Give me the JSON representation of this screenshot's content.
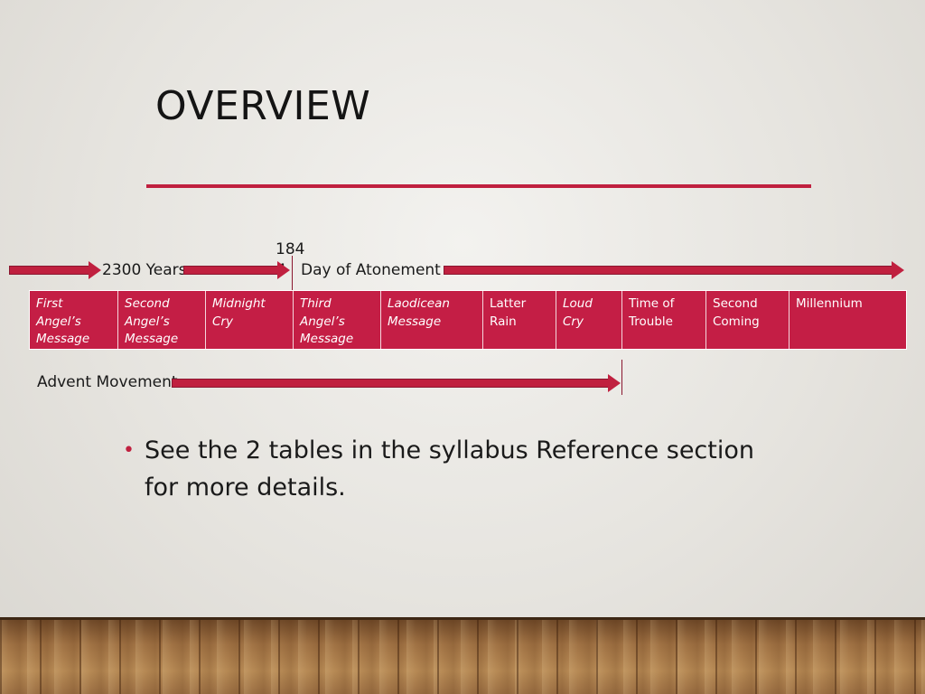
{
  "slide": {
    "title": "OVERVIEW",
    "accent_color": "#c0203f",
    "cell_color": "#c41e45"
  },
  "timeline": {
    "label_2300": "2300 Years",
    "label_1844_top": "184",
    "label_1844_bottom": "4",
    "label_atonement": "Day of Atonement",
    "label_advent": "Advent Movement"
  },
  "table": {
    "cells": [
      {
        "text": "First Angel’s Message",
        "italic": true
      },
      {
        "text": "Second Angel’s Message",
        "italic": true
      },
      {
        "text": "Midnight Cry",
        "italic": true
      },
      {
        "text": "Third Angel’s Message",
        "italic": true
      },
      {
        "text": "Laodicean Message",
        "italic": true
      },
      {
        "text": "Latter Rain",
        "italic": false
      },
      {
        "text": "Loud Cry",
        "italic": true
      },
      {
        "text": "Time of Trouble",
        "italic": false
      },
      {
        "text": "Second Coming",
        "italic": false
      },
      {
        "text": "Millennium",
        "italic": false
      }
    ]
  },
  "bullet": {
    "text": "See the 2 tables in the syllabus Reference section for more details."
  }
}
